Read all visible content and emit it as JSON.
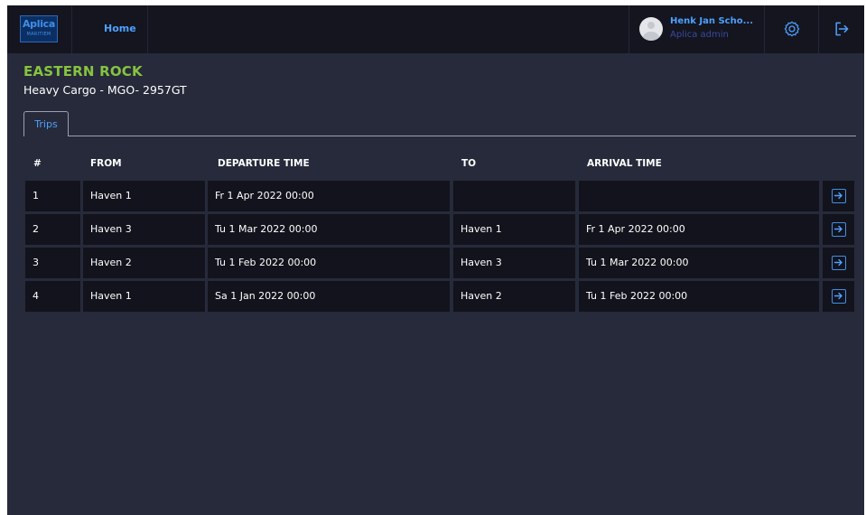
{
  "logo": {
    "line1": "Aplica",
    "line2": "MARITIEM"
  },
  "nav": {
    "home": "Home"
  },
  "user": {
    "name": "Henk Jan Scho...",
    "role": "Aplica admin"
  },
  "ship": {
    "name": "EASTERN ROCK",
    "subtitle": "Heavy Cargo - MGO- 2957GT"
  },
  "tabs": [
    {
      "label": "Trips"
    }
  ],
  "table": {
    "headers": [
      "#",
      "FROM",
      "DEPARTURE TIME",
      "TO",
      "ARRIVAL TIME"
    ],
    "rows": [
      [
        "1",
        "Haven 1",
        "Fr 1 Apr 2022 00:00",
        "",
        ""
      ],
      [
        "2",
        "Haven 3",
        "Tu 1 Mar 2022 00:00",
        "Haven 1",
        "Fr 1 Apr 2022 00:00"
      ],
      [
        "3",
        "Haven 2",
        "Tu 1 Feb 2022 00:00",
        "Haven 3",
        "Tu 1 Mar 2022 00:00"
      ],
      [
        "4",
        "Haven 1",
        "Sa 1 Jan 2022 00:00",
        "Haven 2",
        "Tu 1 Feb 2022 00:00"
      ]
    ]
  },
  "colors": {
    "accent": "#4ea0ff",
    "ship_name": "#86c440",
    "background": "#262a3a",
    "topbar": "#14151f",
    "cell": "#12131c"
  },
  "icons": {
    "settings": "gear-icon",
    "logout": "logout-icon",
    "row_action": "arrow-right-box-icon"
  }
}
